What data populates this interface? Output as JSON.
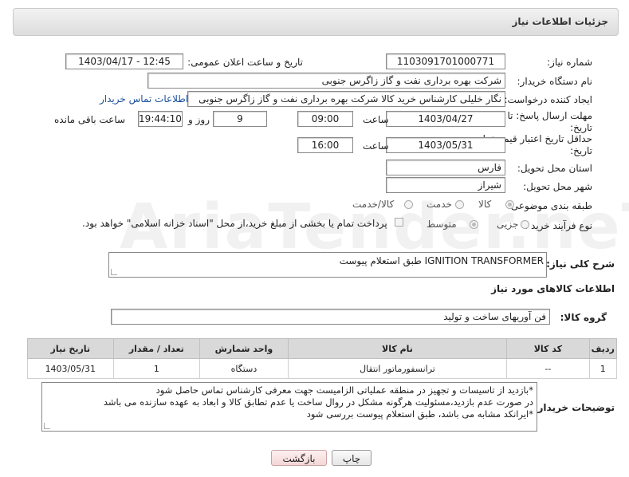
{
  "header": {
    "title": "جزئیات اطلاعات نیاز"
  },
  "form": {
    "need_number_label": "شماره نیاز:",
    "need_number": "1103091701000771",
    "announce_label": "تاریخ و ساعت اعلان عمومی:",
    "announce_value": "1403/04/17 - 12:45",
    "buyer_org_label": "نام دستگاه خریدار:",
    "buyer_org": "شرکت بهره برداری نفت و گاز زاگرس جنوبی",
    "requester_label": "ایجاد کننده درخواست:",
    "requester": "نگار خلیلی کارشناس خرید کالا شرکت بهره برداری نفت و گاز زاگرس جنوبی",
    "buyer_contact_link": "اطلاعات تماس خریدار",
    "reply_deadline_label_1": "مهلت ارسال پاسخ: تا",
    "reply_deadline_label_2": "تاریخ:",
    "reply_date": "1403/04/27",
    "time_label": "ساعت",
    "reply_time": "09:00",
    "days_value": "9",
    "days_label": "روز و",
    "remaining_time": "19:44:10",
    "remaining_label": "ساعت باقی مانده",
    "price_valid_label_1": "حداقل تاریخ اعتبار قیمت: تا",
    "price_valid_label_2": "تاریخ:",
    "price_valid_date": "1403/05/31",
    "price_valid_time": "16:00",
    "province_label": "استان محل تحویل:",
    "province": "فارس",
    "city_label": "شهر محل تحویل:",
    "city": "شیراز",
    "category_label": "طبقه بندی موضوعی:",
    "category_options": [
      "کالا",
      "خدمت",
      "کالا/خدمت"
    ],
    "process_label": "نوع فرآیند خرید :",
    "process_options": [
      "جزیی",
      "متوسط"
    ],
    "payment_note": "پرداخت تمام یا بخشی از مبلغ خرید،از محل \"اسناد خزانه اسلامی\" خواهد بود."
  },
  "description": {
    "label": "شرح کلی نیاز:",
    "value": "IGNITION TRANSFORMER طبق استعلام پیوست"
  },
  "goods_section": {
    "title": "اطلاعات کالاهای مورد نیاز",
    "group_label": "گروه کالا:",
    "group_value": "فن آوریهای ساخت و تولید"
  },
  "table": {
    "headers": [
      "ردیف",
      "کد کالا",
      "نام کالا",
      "واحد شمارش",
      "تعداد / مقدار",
      "تاریخ نیاز"
    ],
    "rows": [
      [
        "1",
        "--",
        "ترانسفورماتور انتقال",
        "دستگاه",
        "1",
        "1403/05/31"
      ]
    ]
  },
  "buyer_notes": {
    "label": "توضیحات خریدار:",
    "lines": [
      "*بازدید از تاسیسات و تجهیز در منطقه عملیاتی الزامیست جهت معرفی کارشناس تماس حاصل شود",
      "در صورت عدم بازدید،مسئولیت هرگونه مشکل در روال ساخت یا عدم تطابق کالا و ابعاد به عهده سازنده می باشد",
      "*ایرانکد مشابه می باشد، طبق استعلام پیوست بررسی شود"
    ]
  },
  "buttons": {
    "print": "چاپ",
    "back": "بازگشت"
  },
  "watermark": "AriaTender.neT"
}
